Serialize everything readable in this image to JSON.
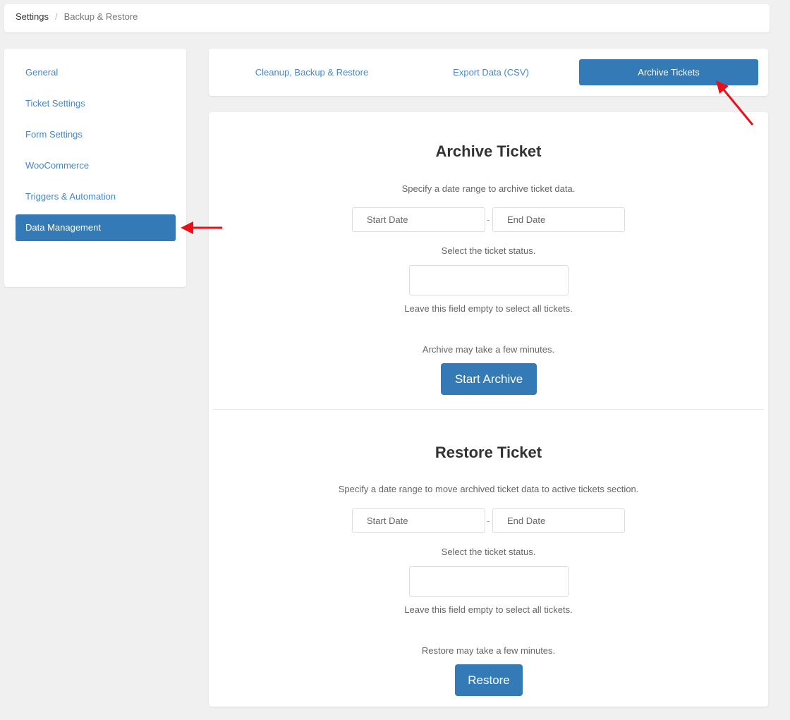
{
  "breadcrumb": {
    "root": "Settings",
    "separator": "/",
    "current": "Backup & Restore"
  },
  "sidebar": {
    "items": [
      {
        "label": "General"
      },
      {
        "label": "Ticket Settings"
      },
      {
        "label": "Form Settings"
      },
      {
        "label": "WooCommerce"
      },
      {
        "label": "Triggers & Automation"
      },
      {
        "label": "Data Management"
      }
    ]
  },
  "tabs": [
    {
      "label": "Cleanup, Backup & Restore"
    },
    {
      "label": "Export Data (CSV)"
    },
    {
      "label": "Archive Tickets"
    }
  ],
  "archive": {
    "title": "Archive Ticket",
    "desc": "Specify a date range to archive ticket data.",
    "start_placeholder": "Start Date",
    "end_placeholder": "End Date",
    "dash": "-",
    "status_label": "Select the ticket status.",
    "hint": "Leave this field empty to select all tickets.",
    "note": "Archive may take a few minutes.",
    "button": "Start Archive"
  },
  "restore": {
    "title": "Restore Ticket",
    "desc": "Specify a date range to move archived ticket data to active tickets section.",
    "start_placeholder": "Start Date",
    "end_placeholder": "End Date",
    "dash": "-",
    "status_label": "Select the ticket status.",
    "hint": "Leave this field empty to select all tickets.",
    "note": "Restore may take a few minutes.",
    "button": "Restore"
  },
  "colors": {
    "accent": "#337ab7",
    "link": "#4a86c5",
    "annotation": "#e8111a"
  }
}
